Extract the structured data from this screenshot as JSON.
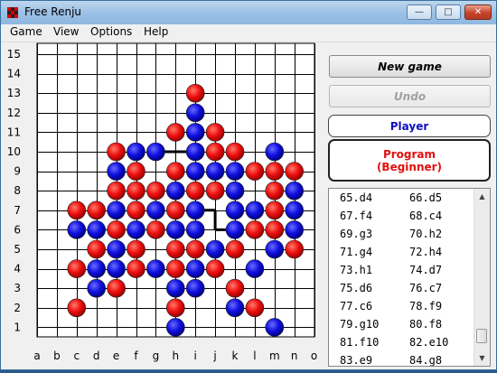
{
  "window": {
    "title": "Free Renju",
    "controls": {
      "minimize": "—",
      "maximize": "□",
      "close": "✕"
    }
  },
  "menu": [
    "Game",
    "View",
    "Options",
    "Help"
  ],
  "board": {
    "columns": [
      "a",
      "b",
      "c",
      "d",
      "e",
      "f",
      "g",
      "h",
      "i",
      "j",
      "k",
      "l",
      "m",
      "n",
      "o"
    ],
    "rows": [
      "15",
      "14",
      "13",
      "12",
      "11",
      "10",
      "9",
      "8",
      "7",
      "6",
      "5",
      "4",
      "3",
      "2",
      "1"
    ],
    "stone_colors": {
      "black_player": "#1010e0",
      "white_player": "#ee1010"
    },
    "stones": [
      {
        "cell": "i13",
        "color": "red"
      },
      {
        "cell": "i12",
        "color": "blue"
      },
      {
        "cell": "h11",
        "color": "red"
      },
      {
        "cell": "i11",
        "color": "blue"
      },
      {
        "cell": "j11",
        "color": "red"
      },
      {
        "cell": "e10",
        "color": "red"
      },
      {
        "cell": "f10",
        "color": "blue"
      },
      {
        "cell": "g10",
        "color": "blue"
      },
      {
        "cell": "i10",
        "color": "blue"
      },
      {
        "cell": "j10",
        "color": "red"
      },
      {
        "cell": "k10",
        "color": "red"
      },
      {
        "cell": "m10",
        "color": "blue"
      },
      {
        "cell": "e9",
        "color": "blue"
      },
      {
        "cell": "f9",
        "color": "red"
      },
      {
        "cell": "h9",
        "color": "red"
      },
      {
        "cell": "i9",
        "color": "blue"
      },
      {
        "cell": "j9",
        "color": "blue"
      },
      {
        "cell": "k9",
        "color": "blue"
      },
      {
        "cell": "l9",
        "color": "red"
      },
      {
        "cell": "m9",
        "color": "red"
      },
      {
        "cell": "n9",
        "color": "red"
      },
      {
        "cell": "e8",
        "color": "red"
      },
      {
        "cell": "f8",
        "color": "red"
      },
      {
        "cell": "g8",
        "color": "red"
      },
      {
        "cell": "h8",
        "color": "blue"
      },
      {
        "cell": "i8",
        "color": "red"
      },
      {
        "cell": "j8",
        "color": "red"
      },
      {
        "cell": "k8",
        "color": "blue"
      },
      {
        "cell": "m8",
        "color": "red"
      },
      {
        "cell": "n8",
        "color": "blue"
      },
      {
        "cell": "c7",
        "color": "red"
      },
      {
        "cell": "d7",
        "color": "red"
      },
      {
        "cell": "e7",
        "color": "blue"
      },
      {
        "cell": "f7",
        "color": "red"
      },
      {
        "cell": "g7",
        "color": "blue"
      },
      {
        "cell": "h7",
        "color": "red"
      },
      {
        "cell": "i7",
        "color": "blue"
      },
      {
        "cell": "k7",
        "color": "blue"
      },
      {
        "cell": "l7",
        "color": "blue"
      },
      {
        "cell": "m7",
        "color": "red"
      },
      {
        "cell": "n7",
        "color": "blue"
      },
      {
        "cell": "c6",
        "color": "blue"
      },
      {
        "cell": "d6",
        "color": "blue"
      },
      {
        "cell": "e6",
        "color": "red"
      },
      {
        "cell": "f6",
        "color": "blue"
      },
      {
        "cell": "g6",
        "color": "red"
      },
      {
        "cell": "h6",
        "color": "blue"
      },
      {
        "cell": "i6",
        "color": "blue"
      },
      {
        "cell": "k6",
        "color": "blue"
      },
      {
        "cell": "l6",
        "color": "red"
      },
      {
        "cell": "m6",
        "color": "red"
      },
      {
        "cell": "n6",
        "color": "blue"
      },
      {
        "cell": "d5",
        "color": "red"
      },
      {
        "cell": "e5",
        "color": "blue"
      },
      {
        "cell": "f5",
        "color": "red"
      },
      {
        "cell": "h5",
        "color": "red"
      },
      {
        "cell": "i5",
        "color": "red"
      },
      {
        "cell": "j5",
        "color": "blue"
      },
      {
        "cell": "k5",
        "color": "red"
      },
      {
        "cell": "m5",
        "color": "blue"
      },
      {
        "cell": "n5",
        "color": "red"
      },
      {
        "cell": "c4",
        "color": "red"
      },
      {
        "cell": "d4",
        "color": "blue"
      },
      {
        "cell": "e4",
        "color": "blue"
      },
      {
        "cell": "f4",
        "color": "red"
      },
      {
        "cell": "g4",
        "color": "blue"
      },
      {
        "cell": "h4",
        "color": "red"
      },
      {
        "cell": "i4",
        "color": "blue"
      },
      {
        "cell": "j4",
        "color": "red"
      },
      {
        "cell": "l4",
        "color": "blue"
      },
      {
        "cell": "d3",
        "color": "blue"
      },
      {
        "cell": "e3",
        "color": "red"
      },
      {
        "cell": "h3",
        "color": "blue"
      },
      {
        "cell": "i3",
        "color": "blue"
      },
      {
        "cell": "k3",
        "color": "red"
      },
      {
        "cell": "c2",
        "color": "red"
      },
      {
        "cell": "h2",
        "color": "red"
      },
      {
        "cell": "k2",
        "color": "blue"
      },
      {
        "cell": "l2",
        "color": "red"
      },
      {
        "cell": "h1",
        "color": "blue"
      },
      {
        "cell": "m1",
        "color": "blue"
      }
    ]
  },
  "buttons": {
    "new_game": "New game",
    "undo": "Undo"
  },
  "players": {
    "player": {
      "label": "Player",
      "color": "#1010c0"
    },
    "program": {
      "label": "Program",
      "level": "(Beginner)",
      "color": "#e01010"
    }
  },
  "moves": [
    [
      "65.d4",
      "66.d5"
    ],
    [
      "67.f4",
      "68.c4"
    ],
    [
      "69.g3",
      "70.h2"
    ],
    [
      "71.g4",
      "72.h4"
    ],
    [
      "73.h1",
      "74.d7"
    ],
    [
      "75.d6",
      "76.c7"
    ],
    [
      "77.c6",
      "78.f9"
    ],
    [
      "79.g10",
      "80.f8"
    ],
    [
      "81.f10",
      "82.e10"
    ],
    [
      "83.e9",
      "84.g8"
    ]
  ]
}
